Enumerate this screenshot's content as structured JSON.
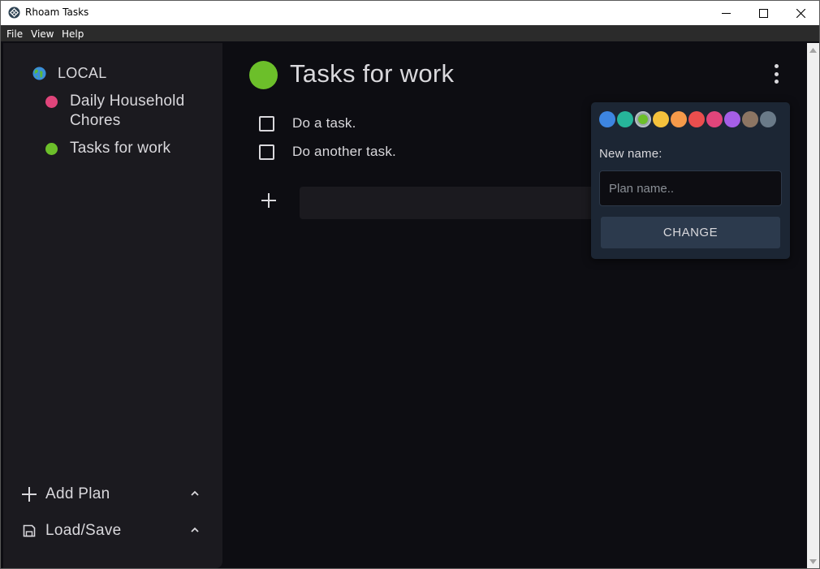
{
  "window": {
    "title": "Rhoam Tasks",
    "icon": "app-logo-icon"
  },
  "menu": {
    "items": [
      "File",
      "View",
      "Help"
    ]
  },
  "sidebar": {
    "store_label": "LOCAL",
    "store_icon": "globe-icon",
    "plans": [
      {
        "label": "Daily Household Chores",
        "color": "#e0457b"
      },
      {
        "label": "Tasks for work",
        "color": "#6cbf2a"
      }
    ],
    "actions": [
      {
        "label": "Add Plan",
        "icon": "plus-icon"
      },
      {
        "label": "Load/Save",
        "icon": "save-icon"
      }
    ]
  },
  "main": {
    "plan_title": "Tasks for work",
    "plan_color": "#6cbf2a",
    "tasks": [
      {
        "label": "Do a task.",
        "checked": false
      },
      {
        "label": "Do another task.",
        "checked": false
      }
    ],
    "new_task_placeholder": ""
  },
  "popup": {
    "swatches": [
      "#3d85e0",
      "#26b59a",
      "#6cbf2a",
      "#f5c23c",
      "#f59a4a",
      "#ea4e4e",
      "#e0457b",
      "#a55ee6",
      "#8c7563",
      "#6a7a88"
    ],
    "selected_swatch": 2,
    "new_name_label": "New name:",
    "input_placeholder": "Plan name..",
    "button_label": "CHANGE"
  },
  "colors": {
    "background": "#0d0d12",
    "sidebar": "#1b1a1f",
    "popup": "#1c2634",
    "text": "#d9d8dc"
  }
}
